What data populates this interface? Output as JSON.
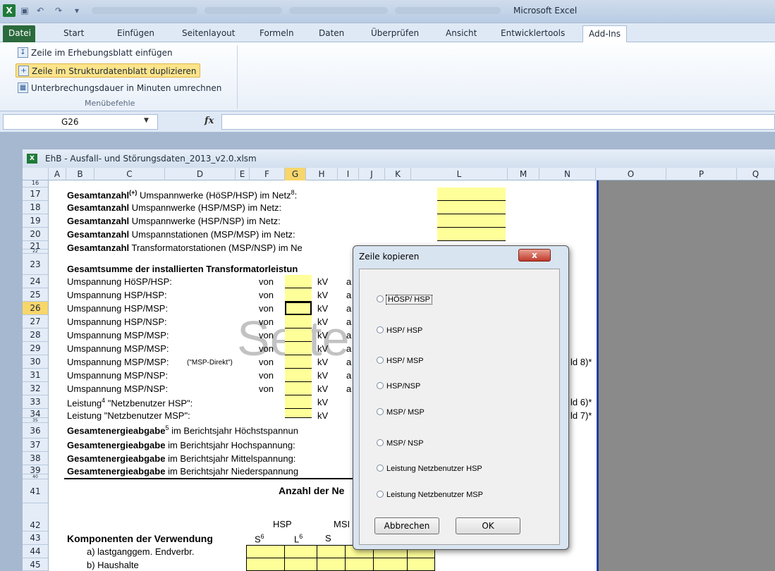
{
  "app": {
    "title": "Microsoft Excel"
  },
  "ribbon": {
    "tabs": [
      "Datei",
      "Start",
      "Einfügen",
      "Seitenlayout",
      "Formeln",
      "Daten",
      "Überprüfen",
      "Ansicht",
      "Entwicklertools",
      "Add-Ins"
    ],
    "active_tab": "Add-Ins",
    "buttons": [
      "Zeile im Erhebungsblatt einfügen",
      "Zeile im Strukturdatenblatt duplizieren",
      "Unterbrechungsdauer in Minuten umrechnen"
    ],
    "group_label": "Menübefehle"
  },
  "formula_bar": {
    "name_box": "G26",
    "fx": "fx",
    "value": ""
  },
  "workbook": {
    "title": "EhB - Ausfall- und Störungsdaten_2013_v2.0.xlsm"
  },
  "columns": [
    "A",
    "B",
    "C",
    "D",
    "E",
    "F",
    "G",
    "H",
    "I",
    "J",
    "K",
    "L",
    "M",
    "N",
    "O",
    "P",
    "Q"
  ],
  "selected_column": "G",
  "rows": [
    "16",
    "17",
    "18",
    "19",
    "20",
    "21",
    "22",
    "23",
    "24",
    "25",
    "26",
    "27",
    "28",
    "29",
    "30",
    "31",
    "32",
    "33",
    "34",
    "35",
    "36",
    "37",
    "38",
    "39",
    "40",
    "41",
    "42",
    "43",
    "44",
    "45"
  ],
  "selected_row": "26",
  "sheet": {
    "r17_b": "Gesamtanzahl",
    "r17_sup": "(+)",
    "r17_t": " Umspannwerke (HöSP/HSP) im Netz",
    "r17_sup2": "8",
    "r17_end": ":",
    "r18_b": "Gesamtanzahl",
    "r18_t": " Umspannwerke (HSP/MSP) im Netz:",
    "r19_b": "Gesamtanzahl",
    "r19_t": " Umspannwerke (HSP/NSP) im Netz:",
    "r20_b": "Gesamtanzahl",
    "r20_t": " Umspannstationen (MSP/MSP) im Netz:",
    "r21_b": "Gesamtanzahl",
    "r21_t": " Transformatorstationen (MSP/NSP) im Ne",
    "r23": "Gesamtsumme der installierten Transformatorleistun",
    "r24": "Umspannung HöSP/HSP:",
    "r25": "Umspannung HSP/HSP:",
    "r26": "Umspannung HSP/MSP:",
    "r27": "Umspannung HSP/NSP:",
    "r28": "Umspannung MSP/MSP:",
    "r29": "Umspannung MSP/MSP:",
    "r30": "Umspannung MSP/MSP:",
    "r30_note": "(\"MSP-Direkt\")",
    "r31": "Umspannung MSP/NSP:",
    "r32": "Umspannung MSP/NSP:",
    "r33_a": "Leistung",
    "r33_sup": "4",
    "r33_b": " \"Netzbenutzer HSP\":",
    "r34": "Leistung \"Netzbenutzer MSP\":",
    "von": "von",
    "kv": "kV",
    "a": "a",
    "n30": "ld 8)*",
    "n33": "ld 6)*",
    "n34": "ld 7)*",
    "r36_b": "Gesamtenergieabgabe",
    "r36_sup": "5",
    "r36_t": " im Berichtsjahr Höchstspannun",
    "r37_b": "Gesamtenergieabgabe",
    "r37_t": " im Berichtsjahr Hochspannung:",
    "r38_b": "Gesamtenergieabgabe",
    "r38_t": " im Berichtsjahr Mittelspannung:",
    "r39_b": "Gesamtenergieabgabe",
    "r39_t": " im Berichtsjahr Niederspannung",
    "r41": "Anzahl der Ne",
    "r42_hsp": "HSP",
    "r42_msp": "MSI",
    "r43": "Komponenten der Verwendung",
    "r43_s": "S",
    "r43_s_sup": "6",
    "r43_l": "L",
    "r43_l_sup": "6",
    "r43_s2": "S",
    "r44": "a) lastganggem. Endverbr.",
    "r45": "b) Haushalte",
    "watermark": "Seite"
  },
  "dialog": {
    "title": "Zeile kopieren",
    "close": "x",
    "options": [
      "HÖSP/ HSP",
      "HSP/ HSP",
      "HSP/ MSP",
      "HSP/NSP",
      "MSP/ MSP",
      "MSP/ NSP",
      "Leistung Netzbenutzer HSP",
      "Leistung Netzbenutzer MSP"
    ],
    "cancel": "Abbrechen",
    "ok": "OK"
  }
}
